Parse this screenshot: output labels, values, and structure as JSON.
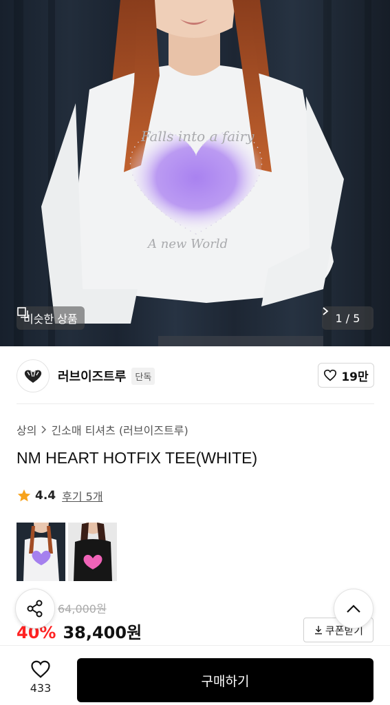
{
  "hero": {
    "similar_label": "비슷한 상품",
    "counter": "1 / 5",
    "print_top": "Falls into a fairy",
    "print_bottom": "A new World"
  },
  "brand": {
    "name": "러브이즈트루",
    "tag": "단독",
    "likes": "19만"
  },
  "breadcrumb": {
    "category": "상의",
    "subcategory": "긴소매 티셔츠 (러브이즈트루)"
  },
  "product": {
    "title": "NM HEART HOTFIX TEE(WHITE)",
    "rating": "4.4",
    "reviews": "후기 5개",
    "original_price": "64,000원",
    "discount": "40%",
    "price": "38,400원",
    "coupon_label": "쿠폰받기"
  },
  "bottom": {
    "wish_count": "433",
    "buy_label": "구매하기"
  },
  "colors": {
    "accent_discount": "#ff2222",
    "buy_button": "#000000",
    "star": "#f7a21b"
  }
}
